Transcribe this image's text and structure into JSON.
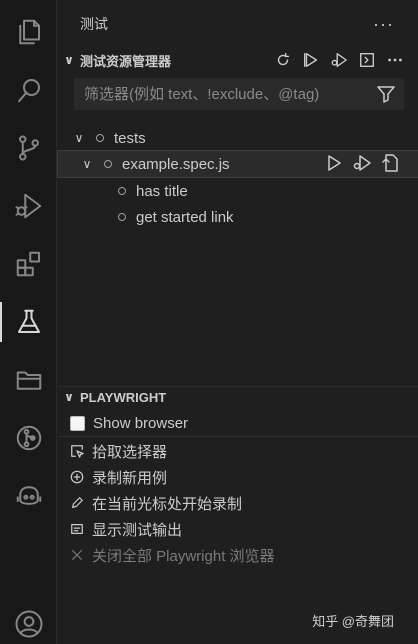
{
  "sidebar": {
    "title": "测试",
    "more": "···"
  },
  "explorer": {
    "header": "测试资源管理器",
    "filter_placeholder": "筛选器(例如 text、!exclude、@tag)"
  },
  "tree": {
    "root": "tests",
    "file": "example.spec.js",
    "tests": [
      "has title",
      "get started link"
    ]
  },
  "playwright": {
    "header": "PLAYWRIGHT",
    "show_browser": "Show browser",
    "pick_locator": "拾取选择器",
    "record_new": "录制新用例",
    "record_at_cursor": "在当前光标处开始录制",
    "reveal_output": "显示测试输出",
    "close_browsers": "关闭全部 Playwright 浏览器"
  },
  "watermark": "知乎 @奇舞团"
}
